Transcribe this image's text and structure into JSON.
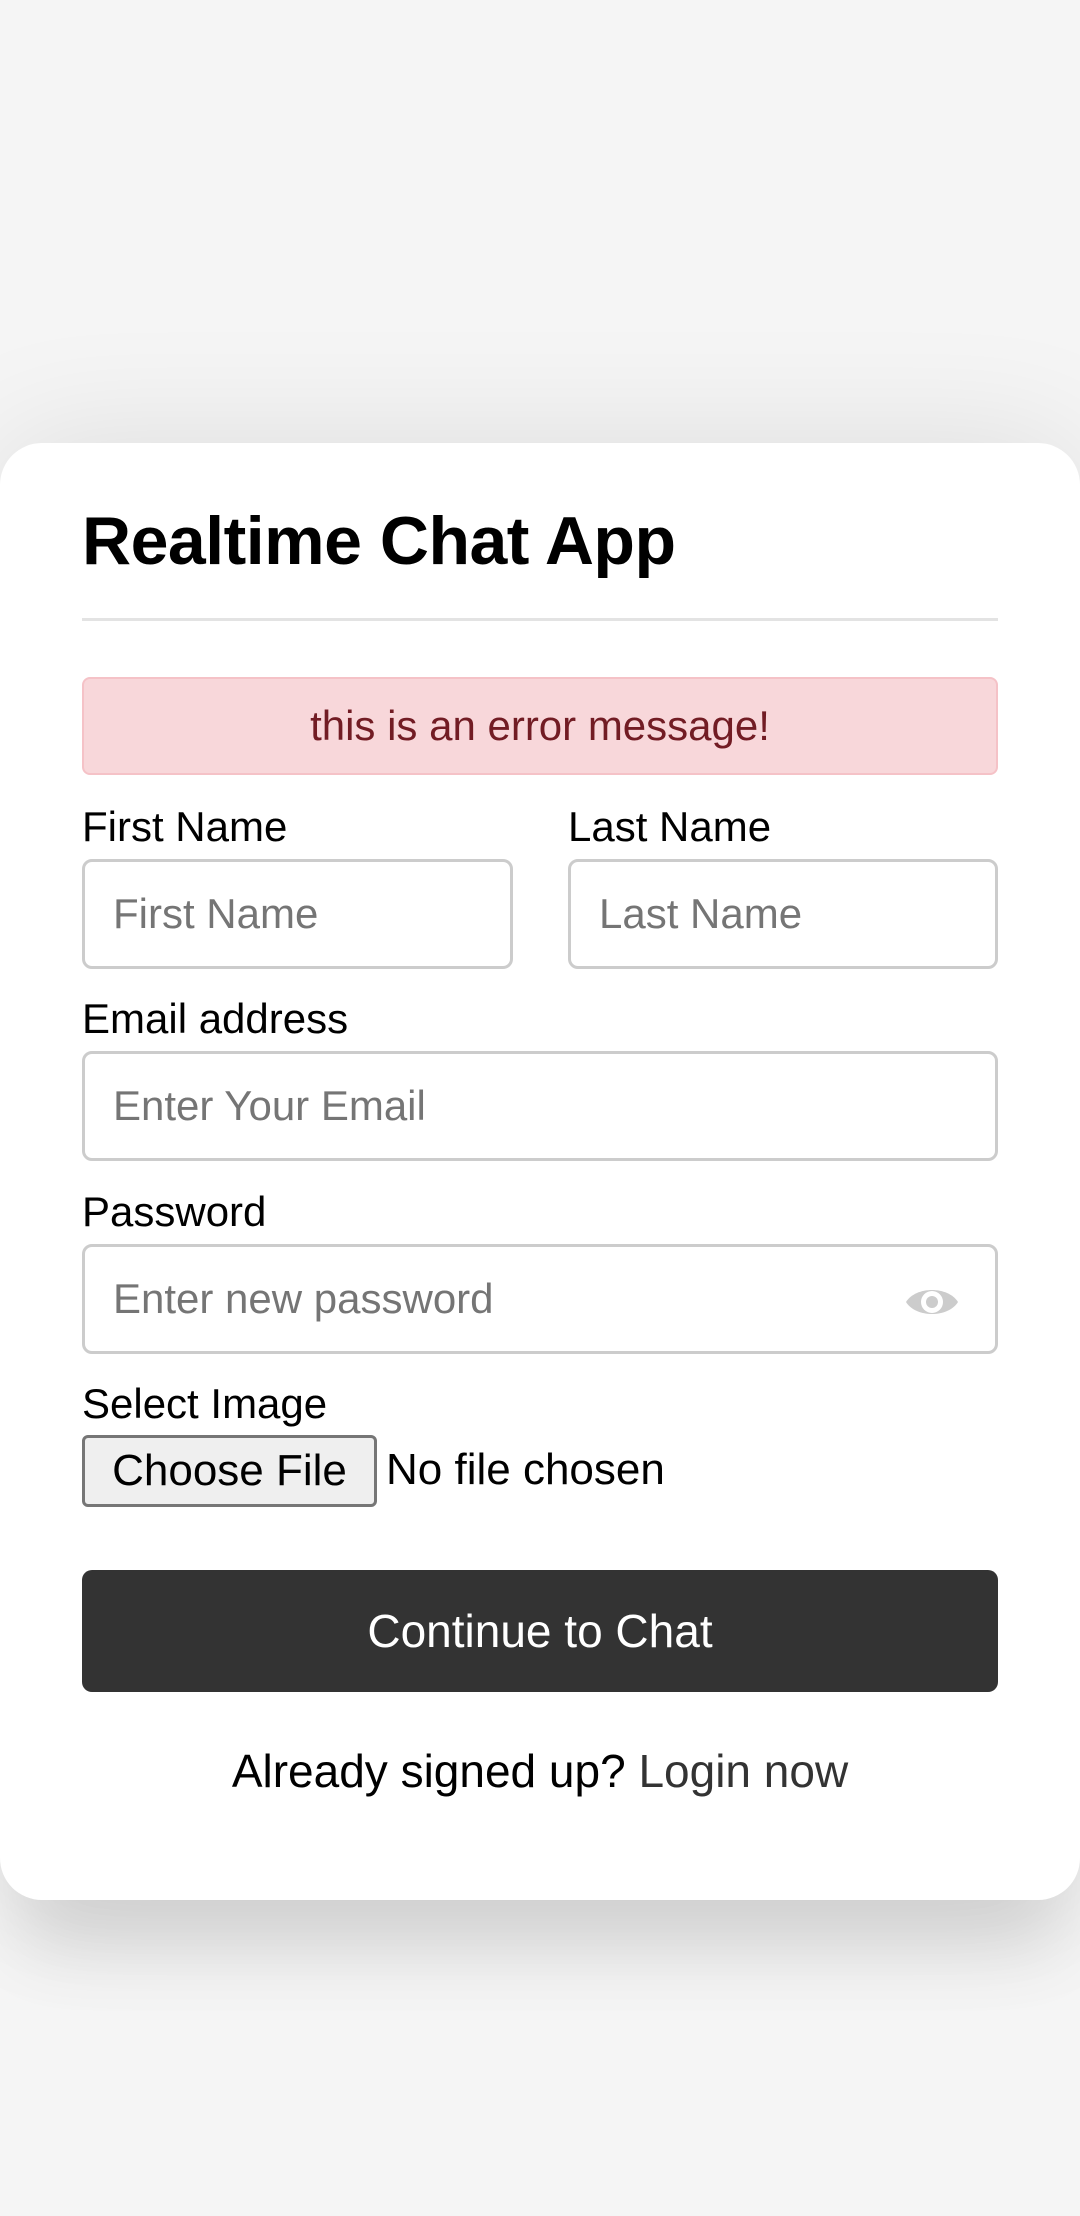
{
  "app": {
    "title": "Realtime Chat App"
  },
  "error": {
    "message": "this is an error message!"
  },
  "form": {
    "first_name": {
      "label": "First Name",
      "placeholder": "First Name",
      "value": ""
    },
    "last_name": {
      "label": "Last Name",
      "placeholder": "Last Name",
      "value": ""
    },
    "email": {
      "label": "Email address",
      "placeholder": "Enter Your Email",
      "value": ""
    },
    "password": {
      "label": "Password",
      "placeholder": "Enter new password",
      "value": "",
      "toggle_icon": "eye-icon"
    },
    "image": {
      "label": "Select Image",
      "button_label": "Choose File",
      "status": "No file chosen"
    },
    "submit_label": "Continue to Chat"
  },
  "footer": {
    "text": "Already signed up?",
    "link_label": "Login now"
  },
  "colors": {
    "background": "#f5f5f5",
    "card": "#ffffff",
    "error_bg": "#f8d7da",
    "error_text": "#721c24",
    "button_bg": "#333333",
    "button_text": "#ffffff",
    "input_border": "#cccccc",
    "icon": "#cccccc"
  }
}
